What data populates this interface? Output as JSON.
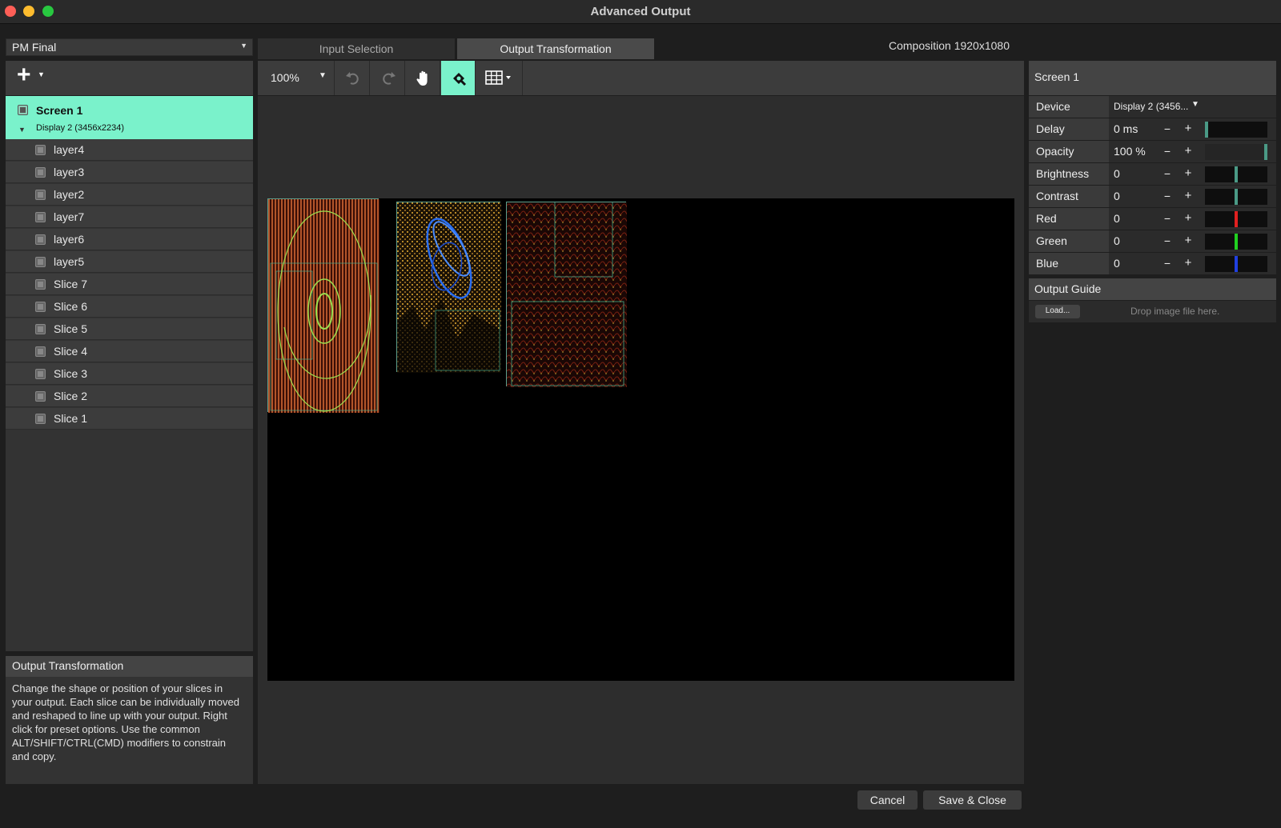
{
  "window": {
    "title": "Advanced Output"
  },
  "preset": {
    "value": "PM Final"
  },
  "tree": {
    "screen": {
      "name": "Screen 1",
      "display": "Display 2 (3456x2234)"
    },
    "layers": [
      "layer4",
      "layer3",
      "layer2",
      "layer7",
      "layer6",
      "layer5",
      "Slice 7",
      "Slice 6",
      "Slice 5",
      "Slice 4",
      "Slice 3",
      "Slice 2",
      "Slice 1"
    ]
  },
  "help": {
    "title": "Output Transformation",
    "body": "Change the shape or position of your slices in your output. Each slice can be individually moved and reshaped to line up with your output. Right click for preset options. Use the common ALT/SHIFT/CTRL(CMD) modifiers to constrain and copy."
  },
  "tabs": {
    "input": "Input Selection",
    "output": "Output Transformation"
  },
  "composition": "Composition 1920x1080",
  "toolbar": {
    "zoom": "100%"
  },
  "right_panel": {
    "header": "Screen 1",
    "device_label": "Device",
    "device_value": "Display 2 (3456...",
    "properties": [
      {
        "label": "Delay",
        "value": "0 ms",
        "level": 0.0,
        "color": "#4a9a86"
      },
      {
        "label": "Opacity",
        "value": "100 %",
        "level": 1.0,
        "color": "#4a9a86"
      },
      {
        "label": "Brightness",
        "value": "0",
        "level": 0.5,
        "color": "#4a9a86"
      },
      {
        "label": "Contrast",
        "value": "0",
        "level": 0.5,
        "color": "#4a9a86"
      },
      {
        "label": "Red",
        "value": "0",
        "level": 0.5,
        "color": "#e02020"
      },
      {
        "label": "Green",
        "value": "0",
        "level": 0.5,
        "color": "#20d020"
      },
      {
        "label": "Blue",
        "value": "0",
        "level": 0.5,
        "color": "#2040e0"
      }
    ],
    "minus": "−",
    "plus": "+",
    "output_guide": {
      "title": "Output Guide",
      "load": "Load...",
      "drop": "Drop image file here."
    }
  },
  "buttons": {
    "cancel": "Cancel",
    "save": "Save & Close"
  },
  "colors": {
    "accent": "#7af2cb",
    "slice_border": "#5d9f8d"
  }
}
